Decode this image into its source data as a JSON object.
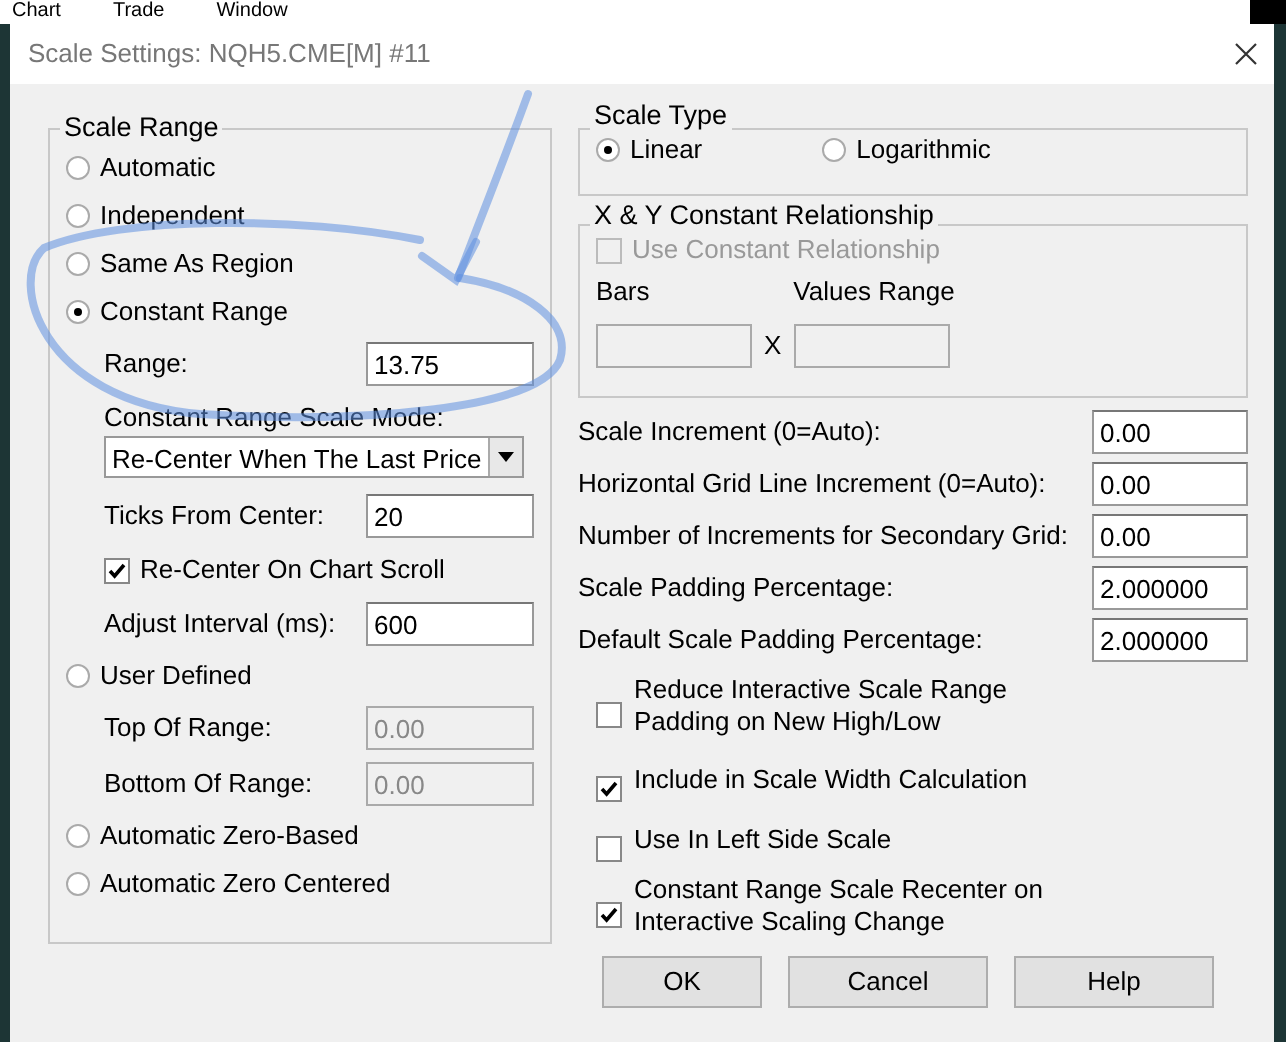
{
  "background_menu": [
    "Chart",
    "Trade",
    "Window"
  ],
  "window": {
    "title": "Scale Settings: NQH5.CME[M] #11"
  },
  "scale_range": {
    "title": "Scale Range",
    "items": [
      {
        "kind": "radio",
        "label": "Automatic",
        "selected": false
      },
      {
        "kind": "radio",
        "label": "Independent",
        "selected": false
      },
      {
        "kind": "radio",
        "label": "Same As Region",
        "selected": false
      },
      {
        "kind": "radio",
        "label": "Constant Range",
        "selected": true,
        "children": [
          {
            "kind": "field",
            "label": "Range:",
            "value": "13.75",
            "disabled": false
          },
          {
            "kind": "select",
            "label": "Constant Range Scale Mode:",
            "value": "Re-Center When The Last Price"
          },
          {
            "kind": "field",
            "label": "Ticks From Center:",
            "value": "20",
            "disabled": false
          },
          {
            "kind": "checkbox",
            "label": "Re-Center On Chart Scroll",
            "checked": true
          },
          {
            "kind": "field",
            "label": "Adjust Interval (ms):",
            "value": "600",
            "disabled": false
          }
        ]
      },
      {
        "kind": "radio",
        "label": "User Defined",
        "selected": false,
        "children": [
          {
            "kind": "field",
            "label": "Top Of Range:",
            "value": "0.00",
            "disabled": true
          },
          {
            "kind": "field",
            "label": "Bottom Of Range:",
            "value": "0.00",
            "disabled": true
          }
        ]
      },
      {
        "kind": "radio",
        "label": "Automatic Zero-Based",
        "selected": false
      },
      {
        "kind": "radio",
        "label": "Automatic Zero Centered",
        "selected": false
      }
    ]
  },
  "scale_type": {
    "title": "Scale Type",
    "options": [
      {
        "label": "Linear",
        "selected": true
      },
      {
        "label": "Logarithmic",
        "selected": false
      }
    ]
  },
  "xy_relationship": {
    "title": "X & Y Constant Relationship",
    "checkbox": {
      "label": "Use Constant Relationship",
      "checked": false,
      "disabled": true
    },
    "bars": {
      "label": "Bars",
      "disabled": true
    },
    "separator": "X",
    "values_range": {
      "label": "Values Range",
      "disabled": true
    }
  },
  "settings_fields": [
    {
      "label": "Scale Increment (0=Auto):",
      "value": "0.00"
    },
    {
      "label": "Horizontal Grid Line Increment (0=Auto):",
      "value": "0.00"
    },
    {
      "label": "Number of Increments for Secondary Grid:",
      "value": "0.00"
    },
    {
      "label": "Scale Padding Percentage:",
      "value": "2.000000"
    },
    {
      "label": "Default Scale Padding Percentage:",
      "value": "2.000000"
    }
  ],
  "options": [
    {
      "label": "Reduce Interactive Scale Range Padding on New High/Low",
      "checked": false
    },
    {
      "label": "Include in Scale Width Calculation",
      "checked": true
    },
    {
      "label": "Use In Left Side Scale",
      "checked": false
    },
    {
      "label": "Constant Range Scale Recenter on Interactive Scaling Change",
      "checked": true
    }
  ],
  "buttons": [
    "OK",
    "Cancel",
    "Help"
  ]
}
